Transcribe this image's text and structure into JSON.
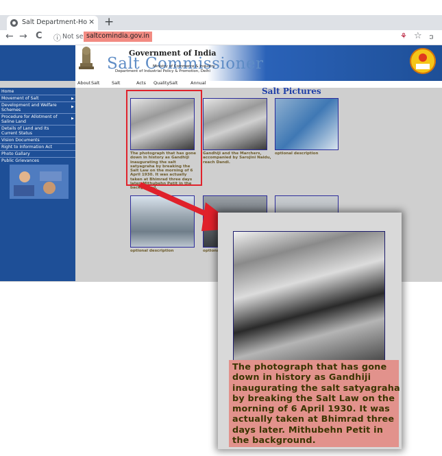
{
  "browser": {
    "tab_title": "Salt Department-Ho",
    "tab_close": "×",
    "new_tab": "+",
    "back": "←",
    "forward": "→",
    "reload": "C",
    "info": "ⓘ",
    "security": "Not secure",
    "url": "saltcomindia.gov.in",
    "extension": "⚘",
    "star": "☆",
    "profile": "ဒ"
  },
  "header": {
    "gov_title": "Government of India",
    "site_title": "Salt Commissioner",
    "ministry": "Ministry of Commerce & Industry",
    "department": "Department of Industrial Policy & Promotion, Delhi"
  },
  "menu": [
    "About",
    "Salt",
    "Salt",
    "Acts",
    "Quality",
    "Salt",
    "Annual"
  ],
  "sidebar": {
    "items": [
      {
        "label": "Home",
        "arrow": false
      },
      {
        "label": "Movement of Salt",
        "arrow": true
      },
      {
        "label": "Development and Welfare",
        "label2": "Schemes",
        "arrow": true
      },
      {
        "label": "Procedure for Allotment of",
        "label2": "Saline Land",
        "arrow": true
      },
      {
        "label": "Details of Land and Its",
        "label2": "Current Status",
        "arrow": false
      },
      {
        "label": "Vision Documents",
        "arrow": false
      },
      {
        "label": "Right to Information Act",
        "arrow": false
      },
      {
        "label": "Photo Gallary",
        "arrow": false
      },
      {
        "label": "Public Grievances",
        "arrow": false
      }
    ]
  },
  "gallery": {
    "heading": "Salt Pictures",
    "row1": [
      {
        "caption": "The photograph that has gone down in history as Gandhiji inaugurating the salt satyagraha by breaking the Salt Law on the morning of 6 April 1930. It was actually taken at Bhimrad three days later. Mithubehn Petit in the background."
      },
      {
        "caption": "Gandhiji and the Marchers, accompanied by Sarojini Naidu, reach Dandi."
      },
      {
        "caption": "optional description"
      }
    ],
    "row2": [
      {
        "caption": "optional description"
      },
      {
        "caption": "optional d"
      }
    ]
  },
  "zoom": {
    "caption": "The photograph that has gone down in history as Gandhiji inaugurating the salt satyagraha by breaking the Salt Law on the morning of 6 April 1930. It was actually taken at Bhimrad three days later. Mithubehn Petit in the background."
  },
  "colors": {
    "header_blue": "#1e4f97",
    "highlight_red": "#e0212b",
    "caption_bg": "#e2928c",
    "url_highlight": "#f28b82"
  }
}
